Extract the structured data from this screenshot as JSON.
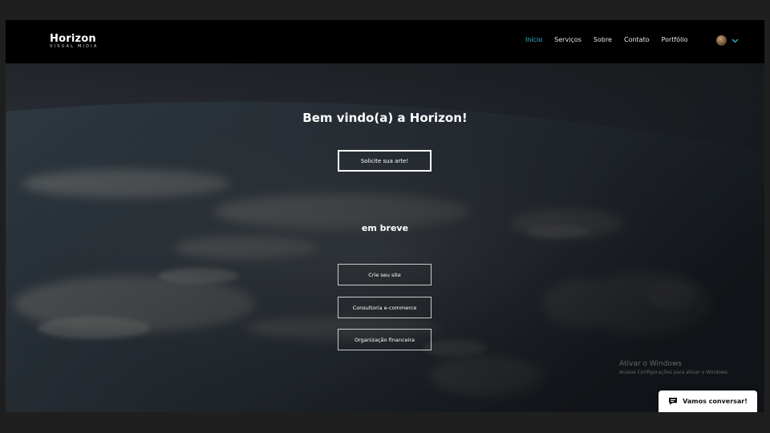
{
  "header": {
    "logo_main": "Horizon",
    "logo_sub": "VISUAL MIDIA",
    "nav": [
      {
        "label": "Início",
        "active": true
      },
      {
        "label": "Serviços",
        "active": false
      },
      {
        "label": "Sobre",
        "active": false
      },
      {
        "label": "Contato",
        "active": false
      },
      {
        "label": "Portfólio",
        "active": false
      }
    ],
    "language_icon": "flag-avatar",
    "language_chevron": "chevron-down-icon",
    "accent_color": "#34b6d6"
  },
  "hero": {
    "title": "Bem vindo(a) a Horizon!",
    "primary_button": "Solicite sua arte!",
    "coming_soon": "em breve",
    "services": [
      "Crie seu site",
      "Consultoria e-commerce",
      "Organização financeira"
    ],
    "background": "earth-from-space-photo"
  },
  "watermark": {
    "title": "Ativar o Windows",
    "subtitle": "Acesse Configurações para ativar o Windows."
  },
  "chat": {
    "label": "Vamos conversar!",
    "icon": "chat-bubble-icon"
  }
}
